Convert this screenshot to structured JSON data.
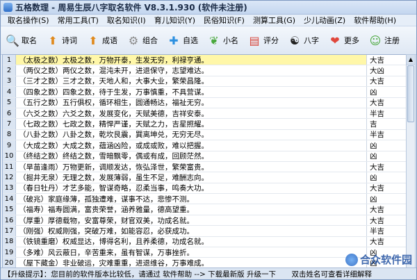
{
  "window": {
    "title": "五格数理 - 周易生辰八字取名软件 V8.3.1.930 (软件未注册)"
  },
  "menu": [
    "取名操作(S)",
    "常用工具(T)",
    "取名知识(I)",
    "育儿知识(Y)",
    "民俗知识(F)",
    "测算工具(G)",
    "少儿动画(Z)",
    "软件帮助(H)"
  ],
  "toolbar": [
    {
      "label": "取名",
      "icon": "magnifier-icon",
      "color": "#2f7de1"
    },
    {
      "label": "诗词",
      "icon": "arrow-up-icon",
      "color": "#e08a1e"
    },
    {
      "label": "成语",
      "icon": "arrow-up-icon",
      "color": "#e08a1e"
    },
    {
      "label": "组合",
      "icon": "gear-icon",
      "color": "#8a8a8a"
    },
    {
      "label": "自选",
      "icon": "plus-circle-icon",
      "color": "#2b8fe0"
    },
    {
      "label": "小名",
      "icon": "leaf-icon",
      "color": "#49a83c"
    },
    {
      "label": "评分",
      "icon": "document-icon",
      "color": "#d8453a"
    },
    {
      "label": "八字",
      "icon": "yin-yang-icon",
      "color": "#222222"
    },
    {
      "label": "更多",
      "icon": "heart-plus-icon",
      "color": "#e0473c"
    },
    {
      "label": "注册",
      "icon": "user-icon",
      "color": "#4aa83c"
    }
  ],
  "rows": [
    {
      "n": "1",
      "text": "（太极之数）太极之数，万物开泰，生发无穷，利禄亨通。",
      "result": "大吉"
    },
    {
      "n": "2",
      "text": "（两仪之数）两仪之数，混沌未开，进退保守，志望难达。",
      "result": "大凶"
    },
    {
      "n": "3",
      "text": "（三才之数）三才之数，天地人和，大事大业，繁荣昌隆。",
      "result": "大吉"
    },
    {
      "n": "4",
      "text": "（四象之数）四象之数，待于生发，万事慎重，不具营谋。",
      "result": "凶"
    },
    {
      "n": "5",
      "text": "（五行之数）五行俱权，循环相生，圆通畅达，福祉无穷。",
      "result": "大吉"
    },
    {
      "n": "6",
      "text": "（六爻之数）六爻之数，发展变化，天赋美德，吉祥安泰。",
      "result": "半吉"
    },
    {
      "n": "7",
      "text": "（七政之数）七政之数，精悍严谨，天赋之力，吉星照耀。",
      "result": "吉"
    },
    {
      "n": "8",
      "text": "（八卦之数）八卦之数，乾坎艮震，巽离坤兑，无穷无尽。",
      "result": "半吉"
    },
    {
      "n": "9",
      "text": "（大成之数）大成之数，蕴涵凶险，或成或败，难以把握。",
      "result": "凶"
    },
    {
      "n": "10",
      "text": "（终结之数）终结之数，雪暗飘零，偶或有成，回顾茫然。",
      "result": "凶"
    },
    {
      "n": "11",
      "text": "（旱苗逢雨）万物更新，调顺发达，恢弘泽世，繁荣富贵。",
      "result": "大吉"
    },
    {
      "n": "12",
      "text": "（掘井无泉）无理之数，发展薄弱，虽生不足，难酬志向。",
      "result": "凶"
    },
    {
      "n": "13",
      "text": "（春日牡丹）才艺多能，智谋奇略，忍柔当事，鸣奏大功。",
      "result": "大吉"
    },
    {
      "n": "14",
      "text": "（破兆）家庭缘薄，孤独遭难，谋事不达，悲惨不测。",
      "result": "凶"
    },
    {
      "n": "15",
      "text": "（福寿）福寿圆满，富贵荣誉，涵养雅量，德高望重。",
      "result": "大吉"
    },
    {
      "n": "16",
      "text": "（厚重）厚德载物，安富尊荣，财官双美，功成名就。",
      "result": "大吉"
    },
    {
      "n": "17",
      "text": "（刚强）权威刚强，突破万难，如能容忍，必获成功。",
      "result": "半吉"
    },
    {
      "n": "18",
      "text": "（铁镜重磨）权威显达，博得名利，且养柔德，功成名就。",
      "result": "大吉"
    },
    {
      "n": "19",
      "text": "（多难）风云蔽日，辛苦重来，虽有智谋，万事挫折。",
      "result": "凶"
    },
    {
      "n": "20",
      "text": "（屋下藏金）非业破运，灾难重重，进退维谷，万事难成。",
      "result": "凶"
    },
    {
      "n": "21",
      "text": "（明月中天）光风霁月，万物确立，官运亨通，大搏名利。女性不宜此数。",
      "result": "大吉"
    }
  ],
  "status": {
    "left": "【升级提示】：您目前的软件版本比较低，请通过 软件帮助 --> 下载最新版 升级一下",
    "right": "双击姓名可查看详细解释"
  },
  "watermark": "合众软件园"
}
